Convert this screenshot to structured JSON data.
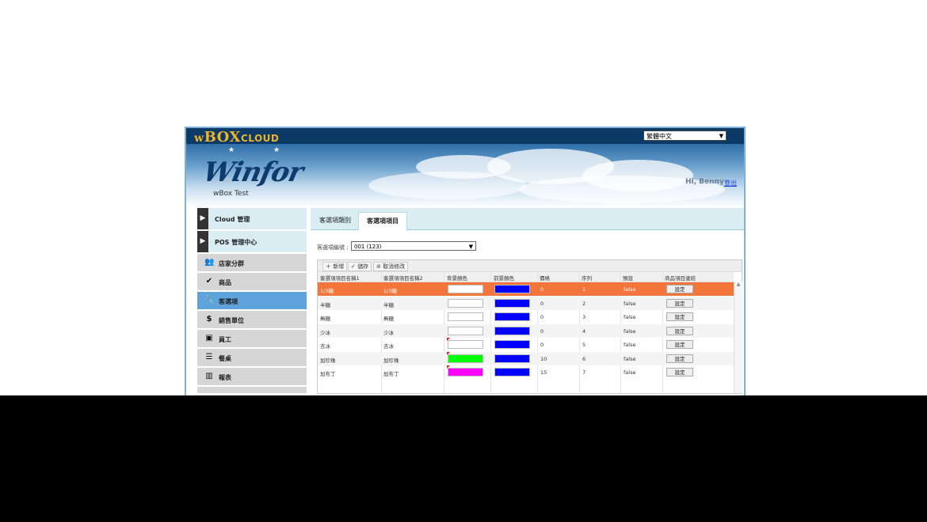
{
  "brand": {
    "w": "w",
    "box": "BOX",
    "cloud": "CLOUD"
  },
  "language": {
    "selected": "繁體中文"
  },
  "header": {
    "logo_text": "Winfor",
    "subtitle": "wBox Test",
    "greeting": "Hi, Benny",
    "logout": "登出"
  },
  "sidebar": {
    "items": [
      {
        "label": "Cloud 管理",
        "icon": "play-triangle-icon",
        "type": "main"
      },
      {
        "label": "POS 管理中心",
        "icon": "play-triangle-icon",
        "type": "main"
      },
      {
        "label": "店家分群",
        "icon": "group-users-icon"
      },
      {
        "label": "商品",
        "icon": "checkmark-icon"
      },
      {
        "label": "客選項",
        "icon": "wrench-icon",
        "active": true
      },
      {
        "label": "銷售單位",
        "icon": "money-icon"
      },
      {
        "label": "員工",
        "icon": "briefcase-icon"
      },
      {
        "label": "餐桌",
        "icon": "list-icon"
      },
      {
        "label": "報表",
        "icon": "bar-chart-icon"
      }
    ]
  },
  "tabs": [
    {
      "label": "客選項類別"
    },
    {
      "label": "客選項項目",
      "active": true
    }
  ],
  "selector": {
    "label": "客選項編號 :",
    "value": "001 (123)"
  },
  "toolbar": {
    "add": "新增",
    "save": "儲存",
    "cancel": "取消修改"
  },
  "table": {
    "headers": [
      "客選項項目名稱1",
      "客選項項目名稱2",
      "背景顏色",
      "前景顏色",
      "價格",
      "序列",
      "預設",
      "商品項目連結"
    ],
    "button_label": "設定",
    "rows": [
      {
        "name1": "1/3糖",
        "name2": "1/3糖",
        "bg": "#ffffff",
        "fg": "#0000ff",
        "price": "0",
        "seq": "1",
        "default": "false",
        "selected": true
      },
      {
        "name1": "半糖",
        "name2": "半糖",
        "bg": "#ffffff",
        "fg": "#0000ff",
        "price": "0",
        "seq": "2",
        "default": "false"
      },
      {
        "name1": "無糖",
        "name2": "無糖",
        "bg": "#ffffff",
        "fg": "#0000ff",
        "price": "0",
        "seq": "3",
        "default": "false"
      },
      {
        "name1": "少冰",
        "name2": "少冰",
        "bg": "#ffffff",
        "fg": "#0000ff",
        "price": "0",
        "seq": "4",
        "default": "false"
      },
      {
        "name1": "去冰",
        "name2": "去冰",
        "bg": "#ffffff",
        "fg": "#0000ff",
        "price": "0",
        "seq": "5",
        "default": "false",
        "dirty": true
      },
      {
        "name1": "加珍珠",
        "name2": "加珍珠",
        "bg": "#00ff00",
        "fg": "#0000ff",
        "price": "10",
        "seq": "6",
        "default": "false",
        "dirty": true
      },
      {
        "name1": "加布丁",
        "name2": "加布丁",
        "bg": "#ff00ff",
        "fg": "#0000ff",
        "price": "15",
        "seq": "7",
        "default": "false",
        "dirty": true
      }
    ]
  },
  "colors": {
    "selected_row": "#f2753c",
    "active_sidebar": "#5fa3dd",
    "topbar": "#0c3a66"
  }
}
